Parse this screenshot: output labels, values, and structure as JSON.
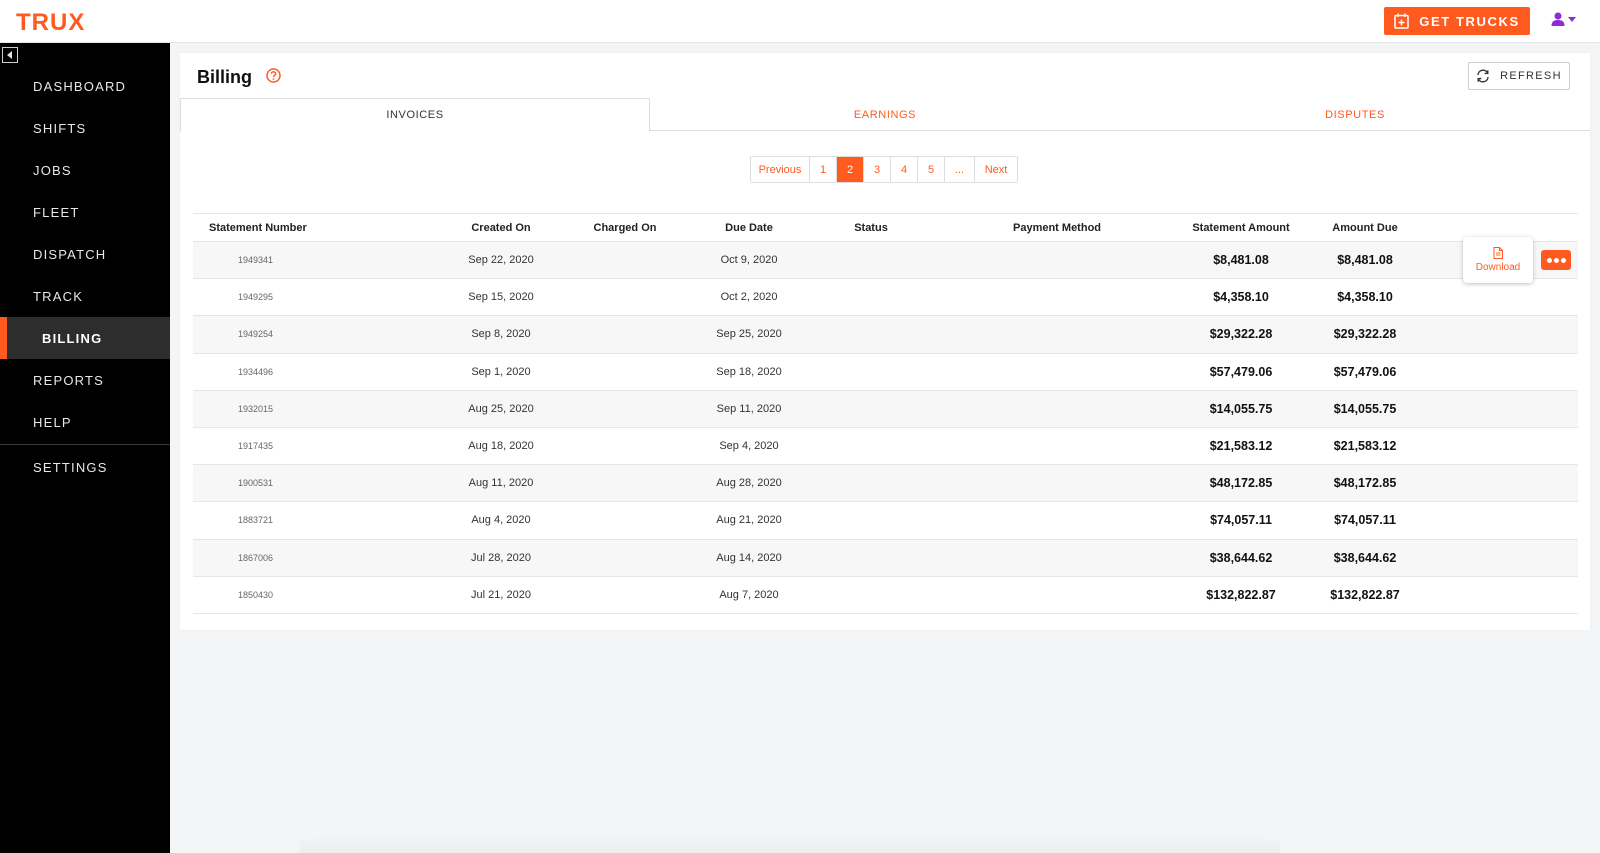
{
  "header": {
    "logo": "TRUX",
    "get_trucks_label": "GET TRUCKS",
    "icons": {
      "get_trucks": "calendar-plus-icon",
      "user": "user-icon",
      "caret": "caret-down-icon"
    },
    "accent_color": "#ff5a1f",
    "user_icon_color": "#8e2bd6"
  },
  "sidebar": {
    "items": [
      {
        "label": "DASHBOARD"
      },
      {
        "label": "SHIFTS"
      },
      {
        "label": "JOBS"
      },
      {
        "label": "FLEET"
      },
      {
        "label": "DISPATCH"
      },
      {
        "label": "TRACK"
      },
      {
        "label": "BILLING",
        "active": true
      },
      {
        "label": "REPORTS"
      },
      {
        "label": "HELP"
      },
      {
        "label": "SETTINGS"
      }
    ]
  },
  "page": {
    "title": "Billing",
    "refresh_label": "REFRESH",
    "tabs": [
      {
        "label": "INVOICES",
        "active": true
      },
      {
        "label": "EARNINGS"
      },
      {
        "label": "DISPUTES"
      }
    ],
    "pagination": {
      "previous": "Previous",
      "pages": [
        "1",
        "2",
        "3",
        "4",
        "5",
        "..."
      ],
      "current": "2",
      "next": "Next"
    }
  },
  "table": {
    "columns": [
      "Statement Number",
      "Created On",
      "Charged On",
      "Due Date",
      "Status",
      "Payment Method",
      "Statement Amount",
      "Amount Due"
    ],
    "rows": [
      {
        "number": "1949341",
        "created": "Sep 22, 2020",
        "charged": "",
        "due": "Oct 9, 2020",
        "status": "",
        "payment": "",
        "statement_amount": "$8,481.08",
        "amount_due": "$8,481.08"
      },
      {
        "number": "1949295",
        "created": "Sep 15, 2020",
        "charged": "",
        "due": "Oct 2, 2020",
        "status": "",
        "payment": "",
        "statement_amount": "$4,358.10",
        "amount_due": "$4,358.10"
      },
      {
        "number": "1949254",
        "created": "Sep 8, 2020",
        "charged": "",
        "due": "Sep 25, 2020",
        "status": "",
        "payment": "",
        "statement_amount": "$29,322.28",
        "amount_due": "$29,322.28"
      },
      {
        "number": "1934496",
        "created": "Sep 1, 2020",
        "charged": "",
        "due": "Sep 18, 2020",
        "status": "",
        "payment": "",
        "statement_amount": "$57,479.06",
        "amount_due": "$57,479.06"
      },
      {
        "number": "1932015",
        "created": "Aug 25, 2020",
        "charged": "",
        "due": "Sep 11, 2020",
        "status": "",
        "payment": "",
        "statement_amount": "$14,055.75",
        "amount_due": "$14,055.75"
      },
      {
        "number": "1917435",
        "created": "Aug 18, 2020",
        "charged": "",
        "due": "Sep 4, 2020",
        "status": "",
        "payment": "",
        "statement_amount": "$21,583.12",
        "amount_due": "$21,583.12"
      },
      {
        "number": "1900531",
        "created": "Aug 11, 2020",
        "charged": "",
        "due": "Aug 28, 2020",
        "status": "",
        "payment": "",
        "statement_amount": "$48,172.85",
        "amount_due": "$48,172.85"
      },
      {
        "number": "1883721",
        "created": "Aug 4, 2020",
        "charged": "",
        "due": "Aug 21, 2020",
        "status": "",
        "payment": "",
        "statement_amount": "$74,057.11",
        "amount_due": "$74,057.11"
      },
      {
        "number": "1867006",
        "created": "Jul 28, 2020",
        "charged": "",
        "due": "Aug 14, 2020",
        "status": "",
        "payment": "",
        "statement_amount": "$38,644.62",
        "amount_due": "$38,644.62"
      },
      {
        "number": "1850430",
        "created": "Jul 21, 2020",
        "charged": "",
        "due": "Aug 7, 2020",
        "status": "",
        "payment": "",
        "statement_amount": "$132,822.87",
        "amount_due": "$132,822.87"
      }
    ],
    "row_menu": {
      "download_label": "Download",
      "icons": {
        "download": "file-icon",
        "more": "more-dots-icon"
      }
    }
  }
}
